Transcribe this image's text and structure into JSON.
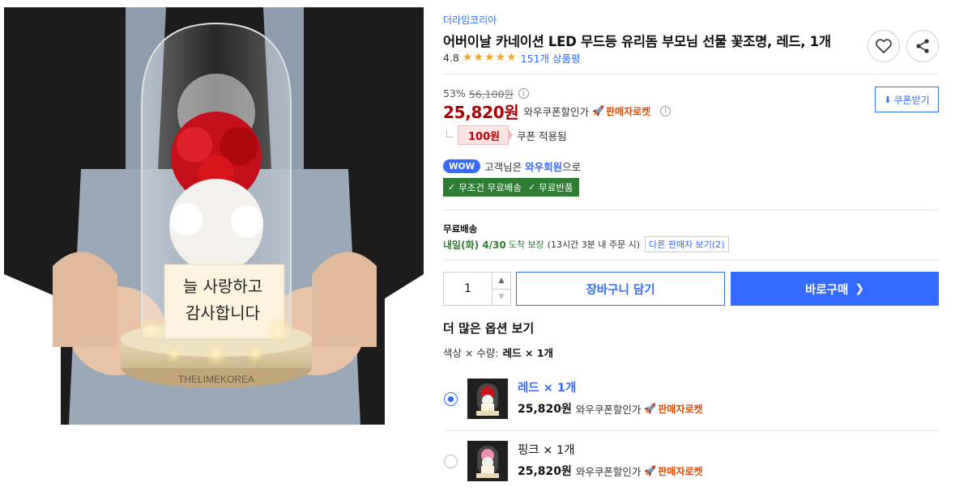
{
  "product": {
    "brand": "더라임코리아",
    "title": "어버이날 카네이션 LED 무드등 유리돔 부모님 선물 꽃조명, 레드, 1개",
    "rating": "4.8",
    "stars": 5,
    "review_link": "151개 상품평",
    "image_text": {
      "line1": "늘 사랑하고",
      "line2": "감사합니다",
      "base": "THELIMEKOREA"
    }
  },
  "actions": {
    "heart_icon": "heart-icon",
    "share_icon": "share-icon"
  },
  "price": {
    "discount": "53%",
    "original": "56,100원",
    "sale": "25,820원",
    "wow_coupon": "와우쿠폰할인가",
    "rocket": "판매자로켓",
    "coupon_button": "쿠폰받기",
    "coupon_amount": "100원",
    "coupon_applied": "쿠폰 적용됨"
  },
  "wow": {
    "pill": "WOW",
    "prefix": "고객님은",
    "member": "와우회원",
    "suffix": "으로",
    "benefit1": "무조건 무료배송",
    "benefit2": "무료반품"
  },
  "shipping": {
    "label": "무료배송",
    "date": "내일(화) 4/30",
    "guarantee": "도착 보장",
    "note": "(13시간 3분 내 주문 시)",
    "other_sellers": "다른 판매자 보기(2)"
  },
  "purchase": {
    "quantity": "1",
    "cart": "장바구니 담기",
    "buy": "바로구매"
  },
  "options": {
    "title": "더 많은 옵션 보기",
    "selected_label": "색상 × 수량:",
    "selected_value": "레드 × 1개",
    "items": [
      {
        "name": "레드 × 1개",
        "price": "25,820원",
        "wow_coupon": "와우쿠폰할인가",
        "rocket": "판매자로켓",
        "selected": true,
        "flower_color": "#d0101a"
      },
      {
        "name": "핑크 × 1개",
        "price": "25,820원",
        "wow_coupon": "와우쿠폰할인가",
        "rocket": "판매자로켓",
        "selected": false,
        "flower_color": "#f28db2"
      }
    ]
  },
  "colors": {
    "accent": "#346aff",
    "sale_red": "#ae0000",
    "rocket_orange": "#e44b00",
    "wow_green": "#2e7d32"
  }
}
